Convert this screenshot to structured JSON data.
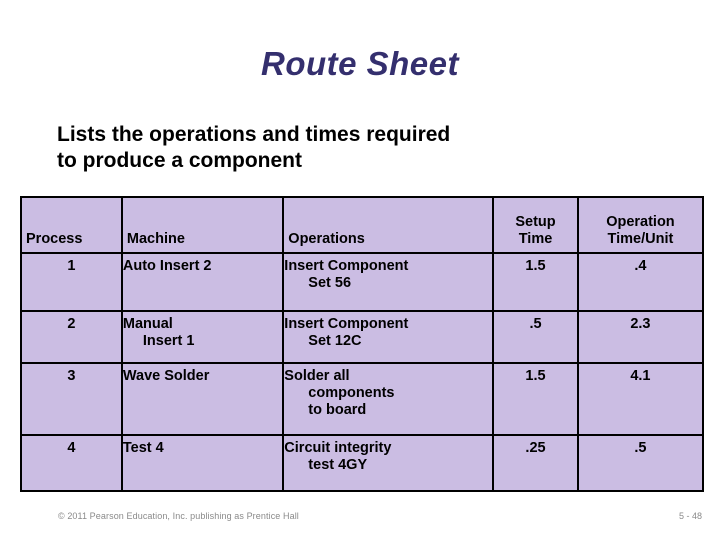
{
  "slide": {
    "title": "Route Sheet",
    "subtitle_line1": "Lists the operations and times required",
    "subtitle_line2": "to produce a component",
    "title_color": "#342F6E",
    "table_cell_color": "#CBBDE3",
    "table_border_color": "#000000"
  },
  "table": {
    "headers": {
      "process": "Process",
      "machine": "Machine",
      "operations": "Operations",
      "setup_time_l1": "Setup",
      "setup_time_l2": "Time",
      "operation_time_l1": "Operation",
      "operation_time_l2": "Time/Unit"
    },
    "rows": [
      {
        "process": "1",
        "machine_l1": "Auto Insert 2",
        "machine_l2": "",
        "operations_l1": "Insert Component",
        "operations_l2": "Set 56",
        "operations_l3": "",
        "setup_time": "1.5",
        "operation_time": ".4"
      },
      {
        "process": "2",
        "machine_l1": "Manual",
        "machine_l2": "Insert 1",
        "operations_l1": "Insert Component",
        "operations_l2": "Set 12C",
        "operations_l3": "",
        "setup_time": ".5",
        "operation_time": "2.3"
      },
      {
        "process": "3",
        "machine_l1": "Wave Solder",
        "machine_l2": "",
        "operations_l1": "Solder all",
        "operations_l2": "components",
        "operations_l3": "to board",
        "setup_time": "1.5",
        "operation_time": "4.1"
      },
      {
        "process": "4",
        "machine_l1": "Test 4",
        "machine_l2": "",
        "operations_l1": "Circuit integrity",
        "operations_l2": "test 4GY",
        "operations_l3": "",
        "setup_time": ".25",
        "operation_time": ".5"
      }
    ]
  },
  "footer": {
    "copyright": "© 2011 Pearson Education, Inc. publishing as Prentice Hall",
    "page_number": "5 - 48"
  }
}
